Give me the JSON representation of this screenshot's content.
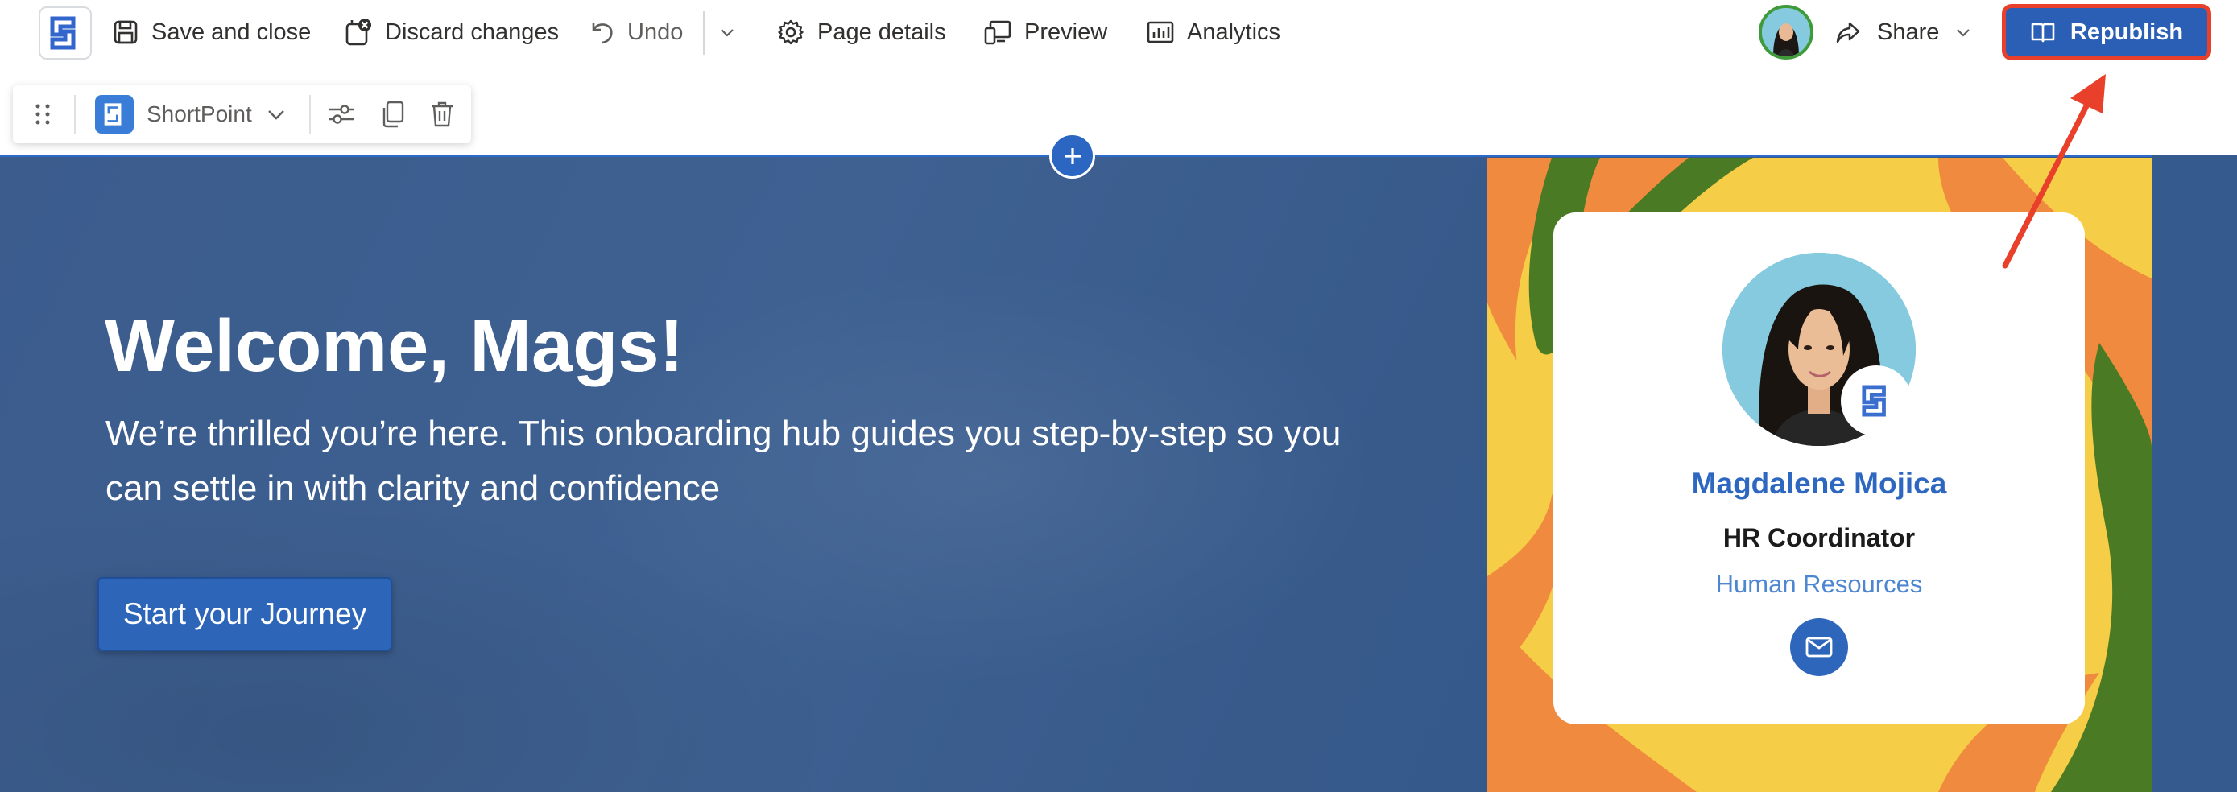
{
  "toolbar": {
    "save_label": "Save and close",
    "discard_label": "Discard changes",
    "undo_label": "Undo",
    "page_details_label": "Page details",
    "preview_label": "Preview",
    "analytics_label": "Analytics",
    "share_label": "Share",
    "republish_label": "Republish"
  },
  "section_toolbar": {
    "webpart_name": "ShortPoint"
  },
  "hero": {
    "title": "Welcome, Mags!",
    "subtitle": "We’re thrilled you’re here. This onboarding hub guides you step-by-step so you can settle in with clarity and confidence",
    "cta_label": "Start your Journey"
  },
  "profile": {
    "name": "Magdalene Mojica",
    "role": "HR Coordinator",
    "department": "Human Resources"
  },
  "colors": {
    "accent": "#2b5fb5",
    "highlight_border": "#e8402a",
    "hero_background": "#3b5c8d",
    "pattern_orange": "#f08a3e",
    "pattern_yellow": "#f6cd47",
    "pattern_green": "#4a7a23"
  },
  "icons": [
    "shortpoint-logo-icon",
    "save-icon",
    "discard-icon",
    "undo-icon",
    "chevron-down-icon",
    "gear-icon",
    "preview-icon",
    "analytics-icon",
    "share-icon",
    "book-icon",
    "drag-handle-icon",
    "settings-sliders-icon",
    "copy-icon",
    "trash-icon",
    "plus-icon",
    "mail-icon"
  ]
}
